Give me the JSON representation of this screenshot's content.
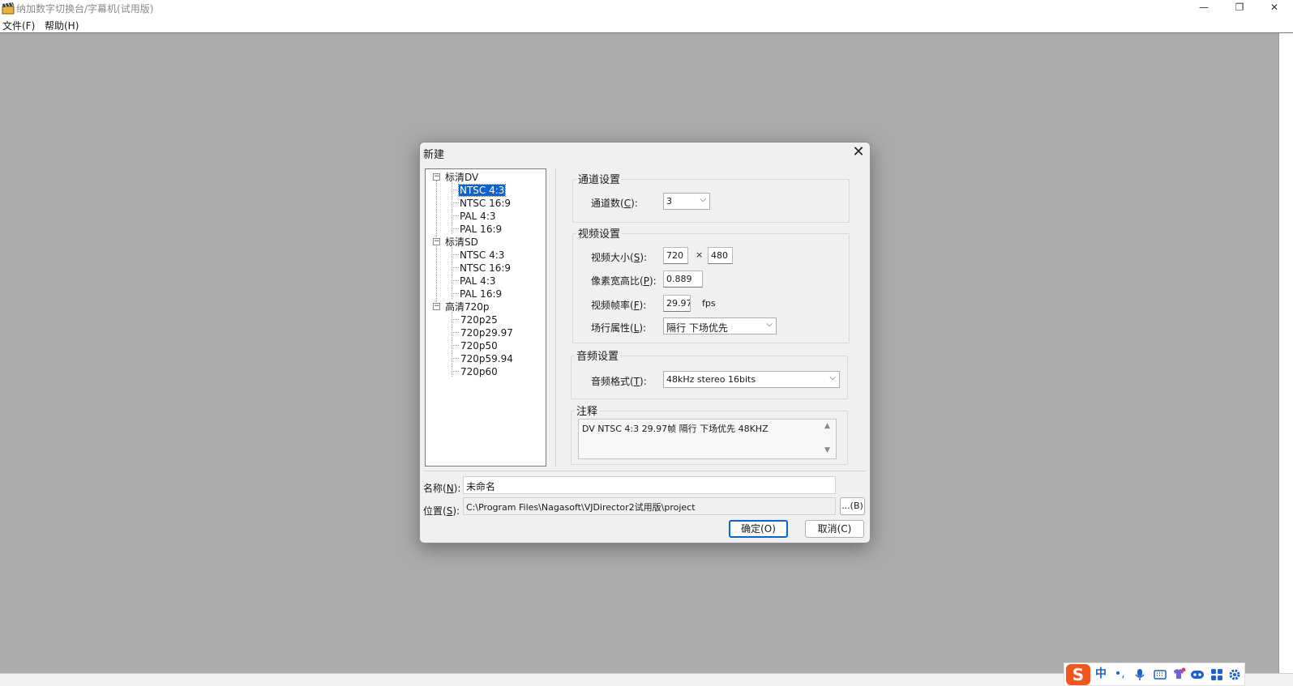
{
  "window": {
    "title": "纳加数字切换台/字幕机(试用版)",
    "min_glyph": "—",
    "max_glyph": "❐",
    "close_glyph": "✕"
  },
  "menu": {
    "items": [
      "文件(F)",
      "帮助(H)"
    ]
  },
  "dialog": {
    "title": "新建",
    "close_glyph": "✕",
    "tree": {
      "groups": [
        {
          "label": "标清DV",
          "children": [
            "NTSC 4:3",
            "NTSC 16:9",
            "PAL 4:3",
            "PAL 16:9"
          ]
        },
        {
          "label": "标清SD",
          "children": [
            "NTSC 4:3",
            "NTSC 16:9",
            "PAL 4:3",
            "PAL 16:9"
          ]
        },
        {
          "label": "高清720p",
          "children": [
            "720p25",
            "720p29.97",
            "720p50",
            "720p59.94",
            "720p60"
          ]
        }
      ],
      "selected": "NTSC 4:3"
    },
    "channel_group": {
      "title": "通道设置",
      "count_label": "通道数(",
      "count_key": "C",
      "count_suffix": "):",
      "count_value": "3"
    },
    "video_group": {
      "title": "视频设置",
      "size_label": "视频大小(",
      "size_key": "S",
      "size_suffix": "):",
      "width": "720",
      "times": "×",
      "height": "480",
      "par_label": "像素宽高比(",
      "par_key": "P",
      "par_suffix": "):",
      "par_value": "0.889",
      "fps_label": "视频帧率(",
      "fps_key": "F",
      "fps_suffix": "):",
      "fps_value": "29.97",
      "fps_unit": "fps",
      "field_label": "场行属性(",
      "field_key": "L",
      "field_suffix": "):",
      "field_value": "隔行 下场优先"
    },
    "audio_group": {
      "title": "音频设置",
      "format_label": "音频格式(",
      "format_key": "T",
      "format_suffix": "):",
      "format_value": "48kHz stereo 16bits"
    },
    "note_group": {
      "title": "注释",
      "text": "DV NTSC 4:3 29.97帧 隔行 下场优先 48KHZ"
    },
    "name": {
      "label": "名称(",
      "key": "N",
      "suffix": "):",
      "value": "未命名"
    },
    "location": {
      "label": "位置(",
      "key": "S",
      "suffix": "):",
      "value": "C:\\Program Files\\Nagasoft\\VJDirector2试用版\\project",
      "browse_label": "...(B)"
    },
    "ok_label": "确定(O)",
    "cancel_label": "取消(C)",
    "dropdown_glyph": "⌵"
  },
  "ime": {
    "logo": "S",
    "mode": "中",
    "punct": "•,",
    "icons": [
      "microphone-icon",
      "keyboard-icon",
      "skin-icon",
      "gamepad-icon",
      "apps-icon",
      "settings-icon"
    ],
    "colors": {
      "logo_bg": "#f2561d",
      "icon": "#1c5fd0"
    }
  }
}
